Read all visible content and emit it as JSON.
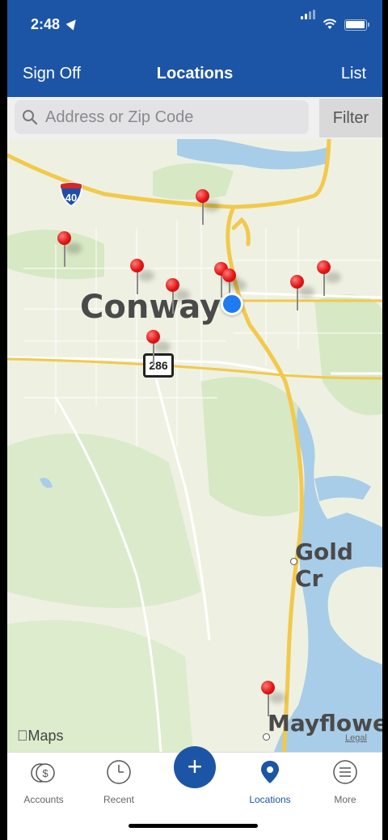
{
  "status": {
    "time": "2:48"
  },
  "nav": {
    "left": "Sign Off",
    "title": "Locations",
    "right": "List"
  },
  "search": {
    "placeholder": "Address or Zip Code",
    "filter": "Filter"
  },
  "map": {
    "towns": [
      "Conway",
      "Gold Cr",
      "Mayflowe"
    ],
    "interstate": "40",
    "route": "286",
    "attribution": "Maps",
    "legal": "Legal"
  },
  "tabs": [
    {
      "label": "Accounts",
      "icon": "dollar-coins-icon"
    },
    {
      "label": "Recent",
      "icon": "clock-icon"
    },
    {
      "label": "",
      "icon": "plus-icon"
    },
    {
      "label": "Locations",
      "icon": "location-pin-icon"
    },
    {
      "label": "More",
      "icon": "menu-icon"
    }
  ],
  "colors": {
    "brand": "#1d55a6",
    "pin": "#e01515",
    "water": "#a8cde8",
    "road": "#f2c94c"
  }
}
